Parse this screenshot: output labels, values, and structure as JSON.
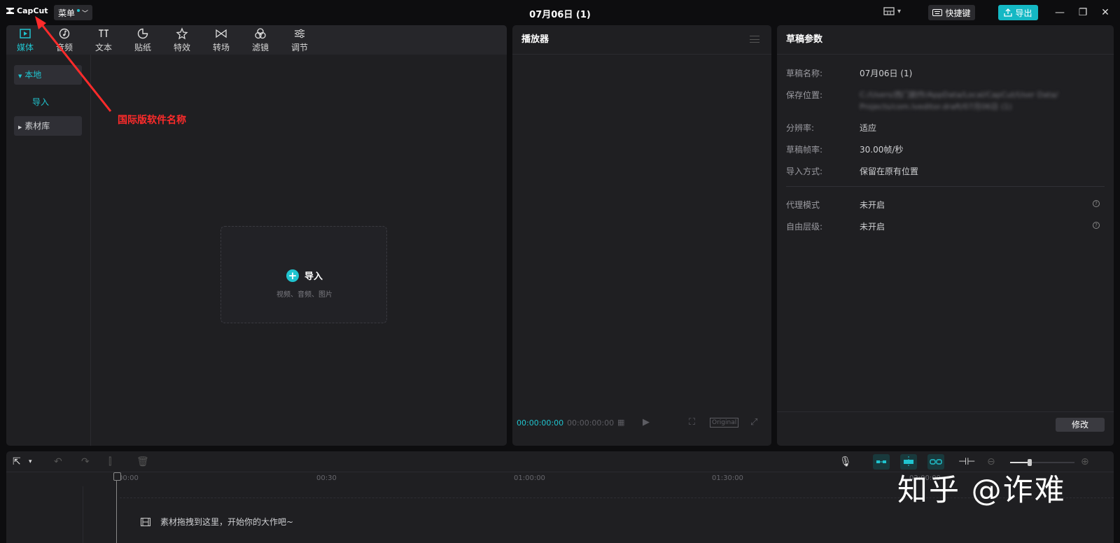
{
  "app": {
    "logo": "CapCut",
    "menu_label": "菜单",
    "project_title": "07月06日 (1)",
    "shortcut_label": "快捷键",
    "export_label": "导出",
    "accent_color": "#20c4cf"
  },
  "media_tabs": [
    {
      "label": "媒体",
      "icon": "media-icon",
      "active": true
    },
    {
      "label": "音频",
      "icon": "audio-icon"
    },
    {
      "label": "文本",
      "icon": "text-icon"
    },
    {
      "label": "贴纸",
      "icon": "sticker-icon"
    },
    {
      "label": "特效",
      "icon": "effects-icon"
    },
    {
      "label": "转场",
      "icon": "transition-icon"
    },
    {
      "label": "滤镜",
      "icon": "filter-icon"
    },
    {
      "label": "调节",
      "icon": "adjust-icon"
    }
  ],
  "sidebar": {
    "local": "本地",
    "import": "导入",
    "library": "素材库"
  },
  "import_box": {
    "label": "导入",
    "hint": "视频、音频、图片"
  },
  "annotation": {
    "text": "国际版软件名称",
    "color": "#ff2b2b"
  },
  "player": {
    "title": "播放器",
    "current_time": "00:00:00:00",
    "total_time": "00:00:00:00",
    "original_label": "Original"
  },
  "props": {
    "title": "草稿参数",
    "rows": [
      {
        "label": "草稿名称:",
        "value": "07月06日 (1)"
      },
      {
        "label": "保存位置:",
        "value": "C:/Users/西门剧作/AppData/Local/CapCut/User Data/ Projects/com.lveditor.draft/07月06日 (1)"
      },
      {
        "label": "分辨率:",
        "value": "适应"
      },
      {
        "label": "草稿帧率:",
        "value": "30.00帧/秒"
      },
      {
        "label": "导入方式:",
        "value": "保留在原有位置"
      },
      {
        "label": "代理模式",
        "value": "未开启"
      },
      {
        "label": "自由层级:",
        "value": "未开启"
      }
    ],
    "modify_label": "修改"
  },
  "timeline": {
    "ruler": [
      "00:00",
      "00:30",
      "01:00:00",
      "01:30:00",
      "02:00:00"
    ],
    "drop_hint": "素材拖拽到这里，开始你的大作吧~",
    "zoom_level": 0.3
  },
  "watermark": "知乎 @诈难"
}
